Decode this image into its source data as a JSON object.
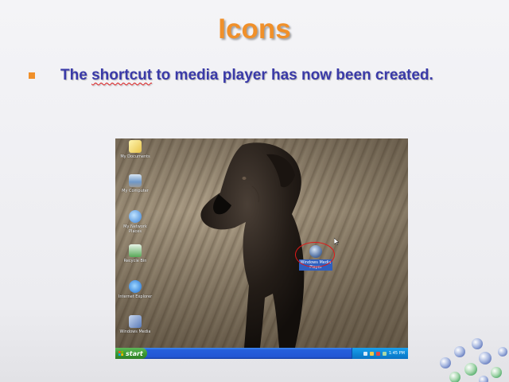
{
  "slide": {
    "title": "Icons",
    "bullet_pre": "The ",
    "bullet_misspelled": "shortcut",
    "bullet_post": " to media player has now been created."
  },
  "colors": {
    "title": "#f0902a",
    "bullet_text": "#3a3aa8",
    "highlight_circle": "#e01818",
    "taskbar": "#245edb",
    "start_button": "#3c9b34"
  },
  "screenshot": {
    "desktop_icons": [
      {
        "label": "My Documents",
        "icon": "folder-icon"
      },
      {
        "label": "My Computer",
        "icon": "computer-icon"
      },
      {
        "label": "My Network Places",
        "icon": "network-icon"
      },
      {
        "label": "Recycle Bin",
        "icon": "recycle-bin-icon"
      },
      {
        "label": "Internet Explorer",
        "icon": "internet-explorer-icon"
      },
      {
        "label": "Windows Media",
        "icon": "media-icon"
      }
    ],
    "new_shortcut": {
      "label": "Windows Media Player",
      "icon": "windows-media-player-icon"
    },
    "taskbar": {
      "start_label": "start",
      "clock": "1:45 PM"
    }
  }
}
